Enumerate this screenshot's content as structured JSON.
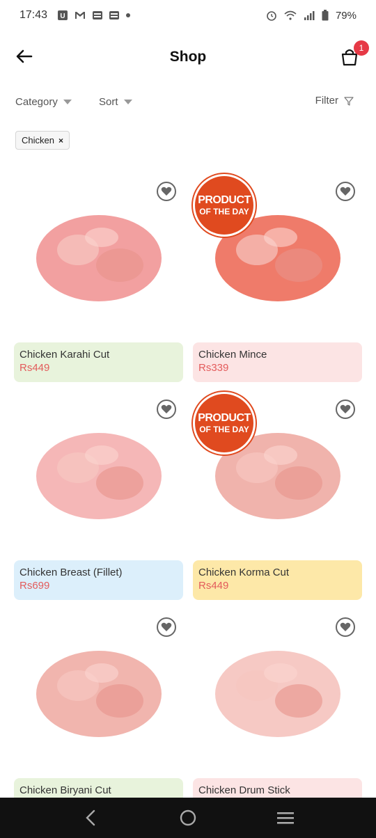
{
  "status": {
    "time": "17:43",
    "battery": "79%",
    "notif_icons": [
      "u-app-icon",
      "gmail-icon",
      "gallery-icon",
      "gallery-icon",
      "dot-icon"
    ],
    "sys_icons": [
      "alarm-icon",
      "wifi-icon",
      "signal-icon",
      "battery-icon"
    ]
  },
  "header": {
    "title": "Shop",
    "cart_count": "1"
  },
  "filters": {
    "category": "Category",
    "sort": "Sort",
    "filter": "Filter"
  },
  "chip": {
    "label": "Chicken",
    "close": "×"
  },
  "badge": {
    "line1": "PRODUCT",
    "line2": "OF THE DAY"
  },
  "products": [
    {
      "name": "Chicken Karahi Cut",
      "price": "Rs449",
      "bg": "#e8f3dc",
      "meat": "#f2a0a0",
      "product_of_day": false
    },
    {
      "name": "Chicken Mince",
      "price": "Rs339",
      "bg": "#fce4e4",
      "meat": "#ef7b6a",
      "product_of_day": true
    },
    {
      "name": "Chicken Breast (Fillet)",
      "price": "Rs699",
      "bg": "#dceffb",
      "meat": "#f5b7b7",
      "product_of_day": false
    },
    {
      "name": "Chicken Korma Cut",
      "price": "Rs449",
      "bg": "#fde8a8",
      "meat": "#f0b3ac",
      "product_of_day": true
    },
    {
      "name": "Chicken Biryani Cut",
      "price": "",
      "bg": "#e8f3dc",
      "meat": "#f1b5ae",
      "product_of_day": false
    },
    {
      "name": "Chicken Drum Stick",
      "price": "",
      "bg": "#fce4e4",
      "meat": "#f6c9c4",
      "product_of_day": false
    }
  ],
  "colors": {
    "accent": "#e35b5b",
    "badge_red": "#e63946",
    "pod_orange": "#e04a1f",
    "nav_bg": "#111111"
  }
}
